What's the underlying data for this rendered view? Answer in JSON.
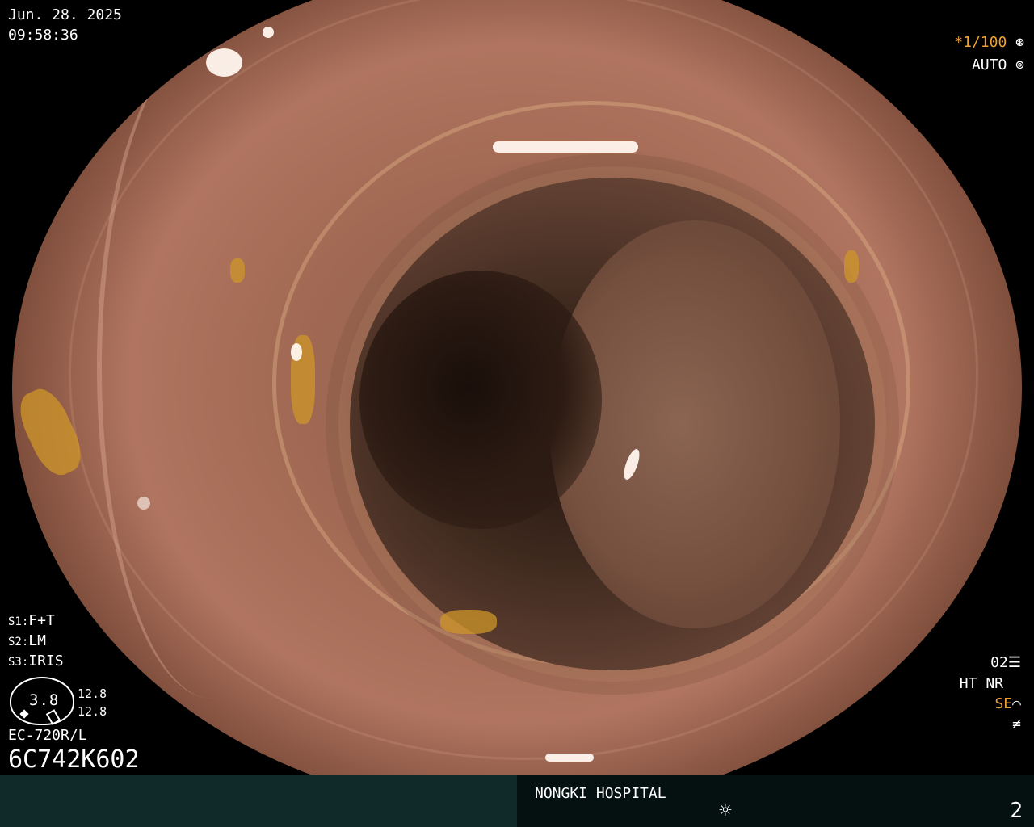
{
  "datetime": {
    "date": "Jun. 28. 2025",
    "time": "09:58:36"
  },
  "top_right": {
    "shutter": "*1/100",
    "shutter_icon": "aperture-icon",
    "exposure_mode": "AUTO",
    "exposure_icon": "aperture-ring-icon"
  },
  "scope_settings": {
    "s1_key": "S1:",
    "s1_value": "F+T",
    "s2_key": "S2:",
    "s2_value": "LM",
    "s3_key": "S3:",
    "s3_value": "IRIS"
  },
  "gauge": {
    "value": "3.8",
    "reading_top": "12.8",
    "reading_bottom": "12.8"
  },
  "scope_model": "EC-720R/L",
  "serial": "6C742K602",
  "right_indicators": {
    "mode": "02",
    "mode_icon": "settings-sliders-icon",
    "ht": "HT",
    "nr": "NR",
    "se": "SE",
    "se_icon": "ramp-icon",
    "extra_icon": "not-equal-icon"
  },
  "footer": {
    "hospital": "NONGKI HOSPITAL",
    "light_icon": "sun-icon",
    "page_number": "2"
  },
  "colors": {
    "accent": "#f0a030",
    "text": "#ffffff",
    "background": "#000000"
  }
}
